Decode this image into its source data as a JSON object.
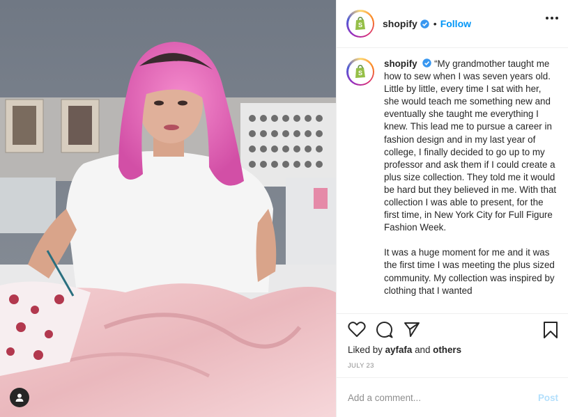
{
  "post": {
    "username": "shopify",
    "follow_label": "Follow",
    "separator": "•",
    "caption_p1": "“My grandmother taught me how to sew when I was seven years old. Little by little, every time I sat with her, she would teach me something new and eventually she taught me everything I knew. This lead me to pursue a career in fashion design and in my last year of college, I finally decided to go up to my professor and ask them if I could create a plus size collection. They told me it would be hard but they believed in me. With that collection I was able to present, for the first time, in New York City for Full Figure Fashion Week.",
    "caption_p2": "It was a huge moment for me and it was the first time I was meeting the plus sized community. My collection was inspired by clothing that I wanted",
    "liked_by_prefix": "Liked by",
    "liked_by_user": "ayfafa",
    "liked_by_and": "and",
    "liked_by_others": "others",
    "date": "JULY 23"
  },
  "comment": {
    "placeholder": "Add a comment...",
    "post_label": "Post"
  },
  "icons": {
    "verified": "verified-badge-icon",
    "more": "more-options-icon",
    "like": "heart-icon",
    "comment": "comment-bubble-icon",
    "share": "paper-plane-icon",
    "save": "bookmark-icon",
    "user_tag": "user-tag-icon"
  },
  "colors": {
    "accent": "#0095f6",
    "post_disabled": "#b2dffc",
    "shopify_green": "#95bf47",
    "hair_pink": "#e868b8"
  }
}
